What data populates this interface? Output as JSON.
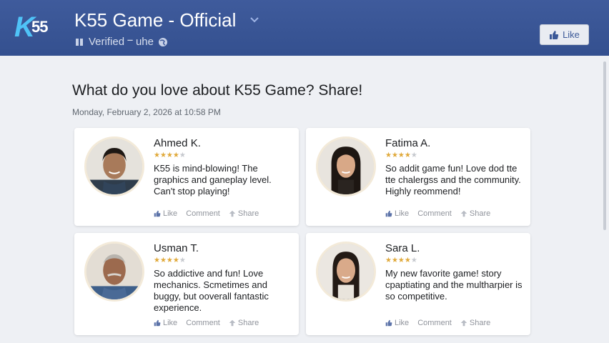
{
  "header": {
    "logo_k": "K",
    "logo_num": "55",
    "title": "K55 Game - Official",
    "verified_text": "Verified ⲻ uhe",
    "like_button": "Like",
    "colors": {
      "bar": "#3f5b9c",
      "accent": "#4fc3f7"
    }
  },
  "post": {
    "question": "What do you love about K55 Game? Share!",
    "date": "Monday, February 2, 2026 at 10:58 PM"
  },
  "reviews": [
    {
      "name": "Ahmed K.",
      "rating": 4,
      "text": "K55 is mind-blowing! The graphics and ganeplay level. Can't stop playing!",
      "actions": {
        "like": "Like",
        "comment": "Comment",
        "share": "Share"
      }
    },
    {
      "name": "Fatima A.",
      "rating": 4,
      "text": "So addit game fun! Love dod tte tte chalergss and the community. Highly reommend!",
      "actions": {
        "like": "Like",
        "comment": "Comment",
        "share": "Share"
      }
    },
    {
      "name": "Usman T.",
      "rating": 4,
      "text": "So addictive and fun! Love mechanics. Scmetimes and buggy, but ooverall fantastic experience.",
      "actions": {
        "like": "Like",
        "comment": "Comment",
        "share": "Share"
      }
    },
    {
      "name": "Sara L.",
      "rating": 4,
      "text": "My new favorite game! story cpaptiating and the multharpier is so competitive.",
      "actions": {
        "like": "Like",
        "comment": "Comment",
        "share": "Share"
      }
    }
  ]
}
